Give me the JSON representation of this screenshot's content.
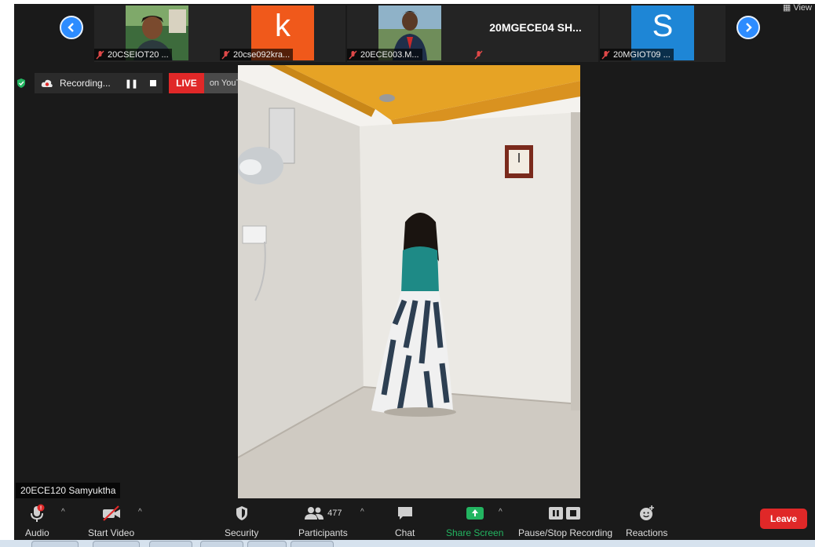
{
  "strip": {
    "participants": [
      {
        "caption": "20CSEIOT20 ..."
      },
      {
        "caption": "20cse092kra...",
        "letter": "k",
        "color": "#f0591b"
      },
      {
        "caption": "20ECE003.M..."
      },
      {
        "name": "20MGECE04  SH...",
        "caption": ""
      },
      {
        "caption": "20MGIOT09 ...",
        "letter": "S",
        "color": "#1e86d6"
      }
    ],
    "view_label": "View"
  },
  "recording": {
    "status": "Recording...",
    "live": "LIVE",
    "platform": "on YouTube"
  },
  "speaker": {
    "name": "20ECE120 Samyuktha"
  },
  "toolbar": {
    "audio": "Audio",
    "start_video": "Start Video",
    "security": "Security",
    "participants": "Participants",
    "participant_count": "477",
    "chat": "Chat",
    "share_screen": "Share Screen",
    "pause_stop_recording": "Pause/Stop Recording",
    "reactions": "Reactions",
    "leave": "Leave"
  },
  "colors": {
    "accent_blue": "#2d8cff",
    "share_green": "#23b561",
    "leave_red": "#e02828"
  }
}
